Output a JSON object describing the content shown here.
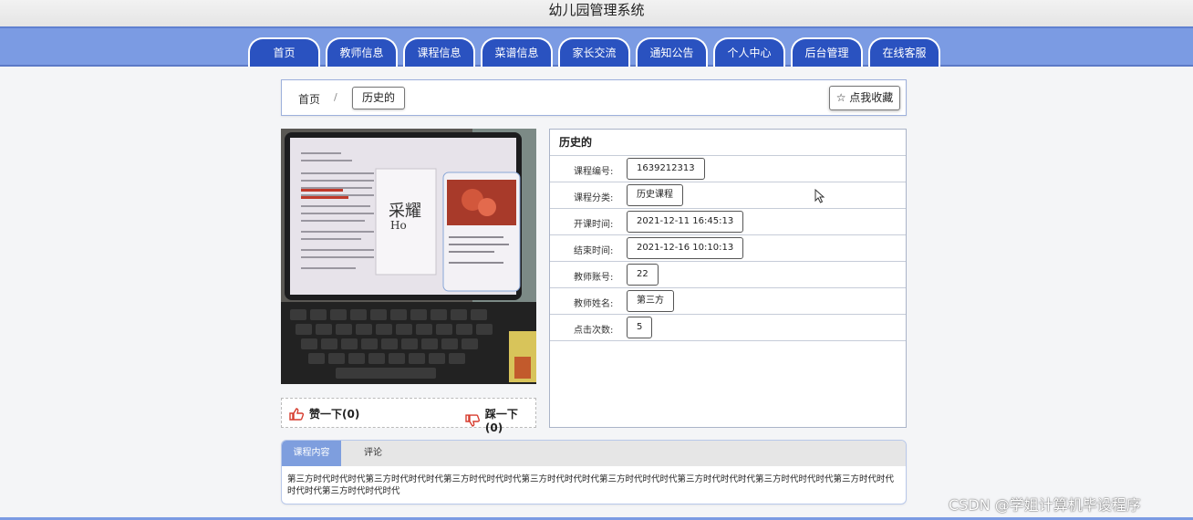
{
  "app": {
    "title": "幼儿园管理系统"
  },
  "nav": {
    "items": [
      {
        "label": "首页"
      },
      {
        "label": "教师信息"
      },
      {
        "label": "课程信息"
      },
      {
        "label": "菜谱信息"
      },
      {
        "label": "家长交流"
      },
      {
        "label": "通知公告"
      },
      {
        "label": "个人中心"
      },
      {
        "label": "后台管理"
      },
      {
        "label": "在线客服"
      }
    ],
    "colors": {
      "bar": "#7b9be3",
      "tab": "#2a52c0"
    }
  },
  "breadcrumb": {
    "home": "首页",
    "separator": "/",
    "current": "历史的"
  },
  "favorite": {
    "label": "☆ 点我收藏"
  },
  "votes": {
    "like": "赞一下(0)",
    "dislike": "踩一下(0)"
  },
  "detail": {
    "title": "历史的",
    "rows": [
      {
        "label": "课程编号:",
        "value": "1639212313"
      },
      {
        "label": "课程分类:",
        "value": "历史课程"
      },
      {
        "label": "开课时间:",
        "value": "2021-12-11 16:45:13"
      },
      {
        "label": "结束时间:",
        "value": "2021-12-16 10:10:13"
      },
      {
        "label": "教师账号:",
        "value": "22"
      },
      {
        "label": "教师姓名:",
        "value": "第三方"
      },
      {
        "label": "点击次数:",
        "value": "5"
      }
    ]
  },
  "content_tabs": {
    "active": "课程内容",
    "other": "评论"
  },
  "content": {
    "text": "第三方时代时代时代第三方时代时代时代第三方时代时代时代第三方时代时代时代第三方时代时代时代第三方时代时代时代第三方时代时代时代第三方时代时代时代时代第三方时代时代时代"
  },
  "photo": {
    "handwriting": "采耀\nHo"
  },
  "watermark": "CSDN @学姐计算机毕设程序"
}
